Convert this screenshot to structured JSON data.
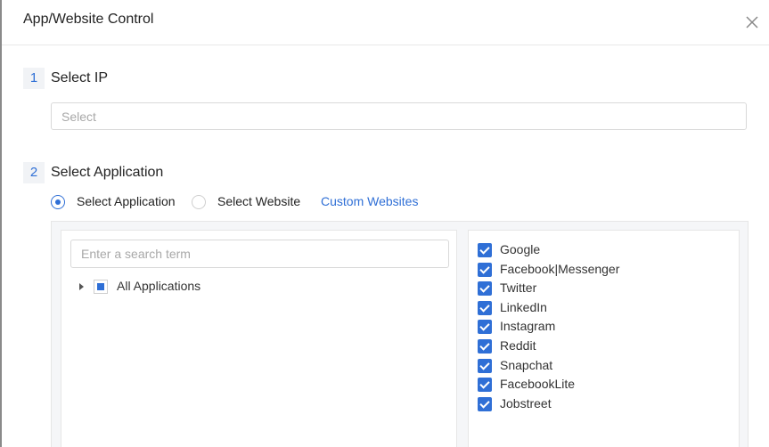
{
  "dialog": {
    "title": "App/Website Control",
    "close_icon": "close-icon"
  },
  "step1": {
    "number": "1",
    "title": "Select IP",
    "placeholder": "Select"
  },
  "step2": {
    "number": "2",
    "title": "Select Application",
    "radio_application": "Select Application",
    "radio_application_selected": true,
    "radio_website": "Select Website",
    "custom_websites_link": "Custom Websites"
  },
  "tree": {
    "search_placeholder": "Enter a search term",
    "all_applications_label": "All Applications",
    "all_applications_state": "partial"
  },
  "selected_list": {
    "items": [
      "Google",
      "Facebook|Messenger",
      "Twitter",
      "LinkedIn",
      "Instagram",
      "Reddit",
      "Snapchat",
      "FacebookLite",
      "Jobstreet"
    ],
    "checked": true
  },
  "colors": {
    "accent": "#2f6fd6",
    "step_badge_bg": "#f1f3f6",
    "border": "#d9d9d9"
  }
}
